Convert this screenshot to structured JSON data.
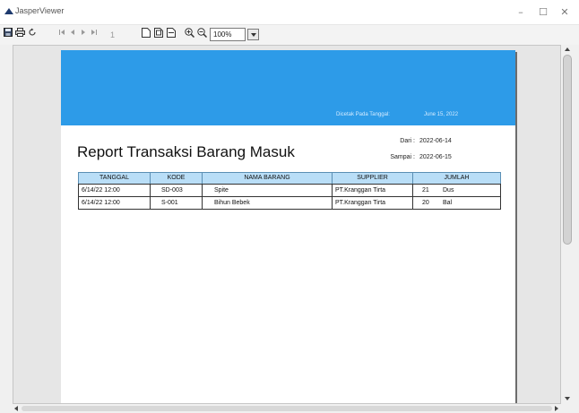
{
  "window": {
    "title": "JasperViewer",
    "controls": [
      "–",
      "☐",
      "✕"
    ]
  },
  "toolbar": {
    "icons": [
      "save-icon",
      "print-icon",
      "reload-icon",
      "first-page-icon",
      "previous-page-icon",
      "next-page-icon",
      "last-page-icon",
      "actual-size-icon",
      "fit-page-icon",
      "fit-width-icon",
      "zoom-in-icon",
      "zoom-out-icon"
    ],
    "page_number": "1",
    "zoom": "100%"
  },
  "report": {
    "printed_label": "Dicetak Pada Tanggal:",
    "printed_date": "June 15, 2022",
    "title": "Report Transaksi Barang Masuk",
    "from_label": "Dari :",
    "from_value": "2022-06-14",
    "to_label": "Sampai :",
    "to_value": "2022-06-15",
    "columns": [
      "TANGGAL",
      "KODE",
      "NAMA BARANG",
      "SUPPLIER",
      "JUMLAH"
    ],
    "rows": [
      {
        "tanggal": "6/14/22 12:00",
        "kode": "SD-003",
        "nama": "Spite",
        "supplier": "PT.Kranggan Tirta",
        "qty": "21",
        "unit": "Dus"
      },
      {
        "tanggal": "6/14/22 12:00",
        "kode": "S-001",
        "nama": "Bihun Bebek",
        "supplier": "PT.Kranggan Tirta",
        "qty": "20",
        "unit": "Bal"
      }
    ]
  },
  "colors": {
    "banner": "#2d9be8",
    "header_fill": "#b9def7"
  }
}
